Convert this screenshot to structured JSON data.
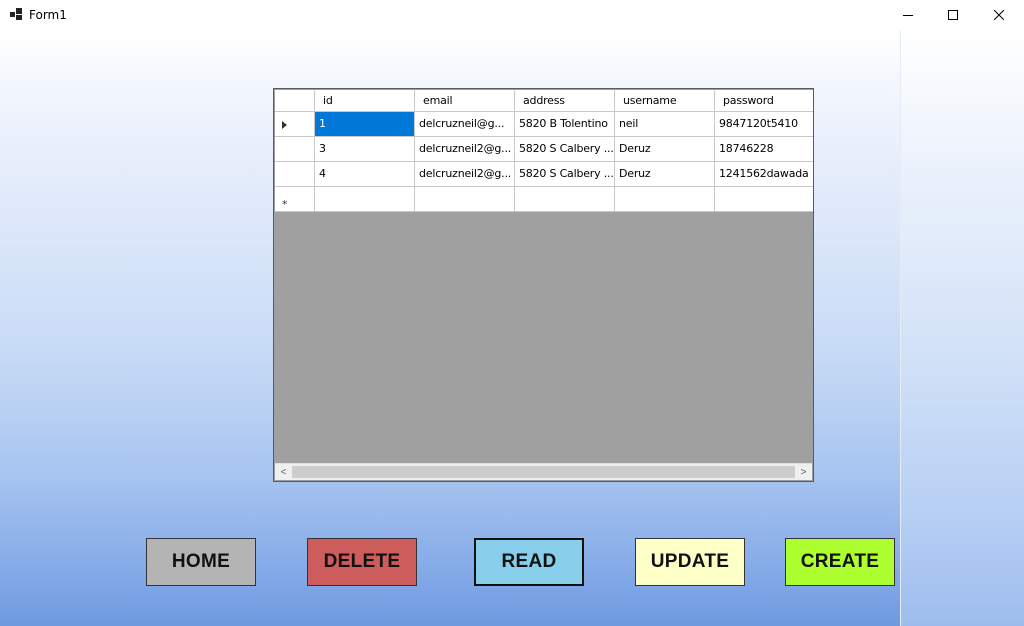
{
  "window": {
    "title": "Form1",
    "minimize_glyph": "—",
    "maximize_glyph": "☐",
    "close_glyph": "✕"
  },
  "grid": {
    "columns": [
      "id",
      "email",
      "address",
      "username",
      "password"
    ],
    "rows": [
      {
        "id": "1",
        "email": "delcruzneil@g...",
        "address": "5820 B Tolentino",
        "username": "neil",
        "password": "9847120t5410",
        "selected": true
      },
      {
        "id": "3",
        "email": "delcruzneil2@g...",
        "address": "5820 S Calbery ...",
        "username": "Deruz",
        "password": "18746228"
      },
      {
        "id": "4",
        "email": "delcruzneil2@g...",
        "address": "5820 S Calbery ...",
        "username": "Deruz",
        "password": "1241562dawada"
      }
    ],
    "new_row_marker": "*",
    "scroll_left_glyph": "<",
    "scroll_right_glyph": ">"
  },
  "buttons": {
    "home": {
      "label": "HOME",
      "color": "#b4b4b4"
    },
    "delete": {
      "label": "DELETE",
      "color": "#cd5c5c"
    },
    "read": {
      "label": "READ",
      "color": "#87ceeb"
    },
    "update": {
      "label": "UPDATE",
      "color": "#ffffc8"
    },
    "create": {
      "label": "CREATE",
      "color": "#adff2f"
    }
  },
  "colors": {
    "selection": "#0078d7",
    "grid_background": "#a0a0a0"
  }
}
